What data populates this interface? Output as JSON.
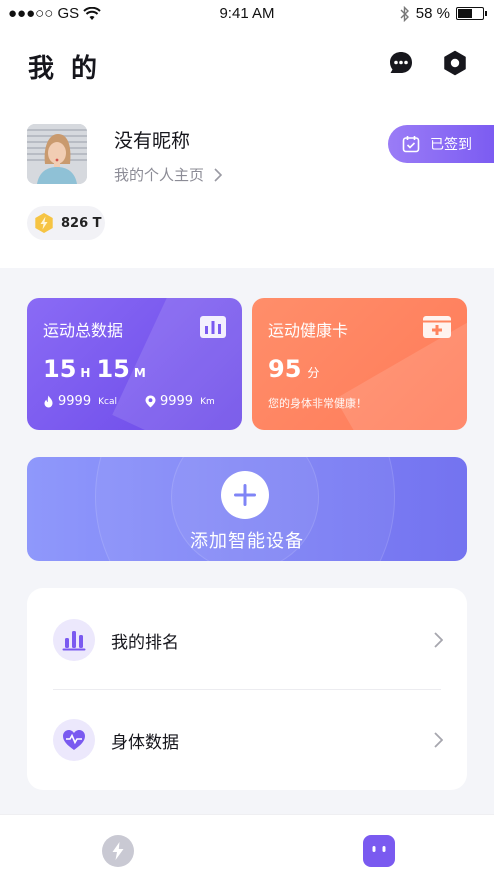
{
  "status_bar": {
    "carrier": "●●●○○ GS",
    "time": "9:41 AM",
    "battery_percent": "58 %",
    "battery_level": 0.58
  },
  "header": {
    "title": "我 的",
    "icons": [
      "chat-icon",
      "settings-hexagon-icon"
    ]
  },
  "profile": {
    "nickname": "没有昵称",
    "homepage_link": "我的个人主页",
    "checkin_label": "已签到",
    "points": "826 T"
  },
  "cards": {
    "sport": {
      "title": "运动总数据",
      "hours": "15",
      "hours_unit": "H",
      "minutes": "15",
      "minutes_unit": "M",
      "calories": "9999",
      "calories_unit": "Kcal",
      "distance": "9999",
      "distance_unit": "Km"
    },
    "health": {
      "title": "运动健康卡",
      "score": "95",
      "score_unit": "分",
      "message": "您的身体非常健康！"
    }
  },
  "add_device": {
    "label": "添加智能设备"
  },
  "menu": {
    "items": [
      {
        "label": "我的排名",
        "icon": "ranking-bar-icon"
      },
      {
        "label": "身体数据",
        "icon": "heart-pulse-icon"
      }
    ]
  },
  "tab_bar": {
    "tabs": [
      {
        "icon": "lightning-icon",
        "active": false
      },
      {
        "icon": "robot-face-icon",
        "active": true
      }
    ]
  },
  "colors": {
    "accent_purple": "#7c5cf2",
    "sport_card": "#7a5af0",
    "health_card": "#ff845f",
    "add_device": "#7f84f6"
  }
}
